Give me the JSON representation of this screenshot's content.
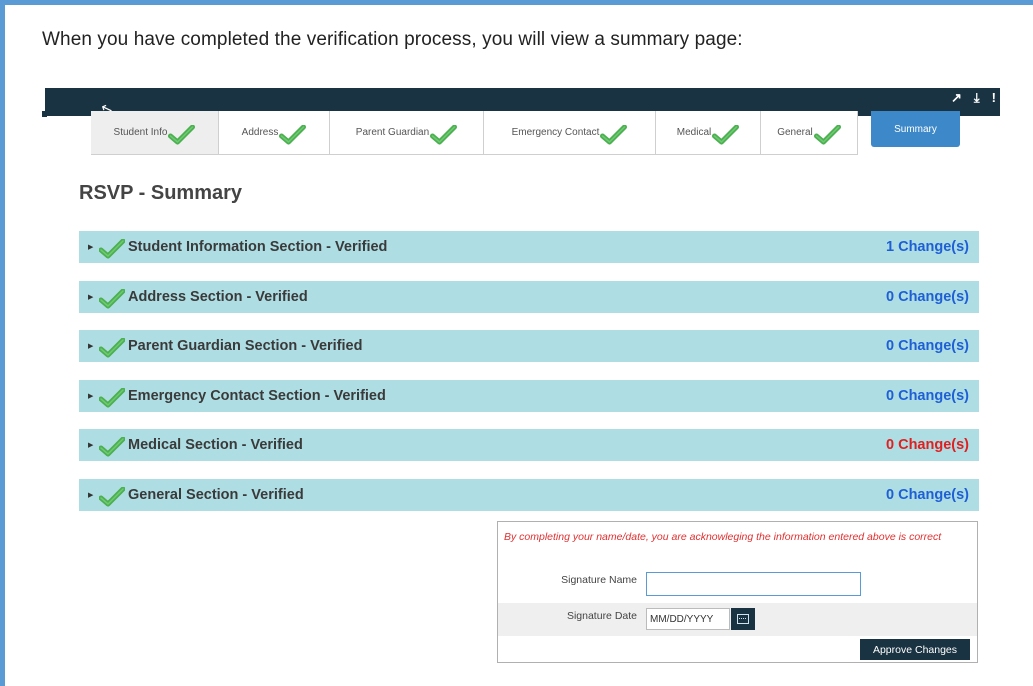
{
  "intro_text": "When you have completed the verification process, you will view a summary page:",
  "topbar": {
    "icons": [
      "external-link-icon",
      "download-icon",
      "alert-icon"
    ],
    "color": "#1a3342"
  },
  "tabs": [
    {
      "label": "Student Info",
      "verified": true
    },
    {
      "label": "Address",
      "verified": true
    },
    {
      "label": "Parent Guardian",
      "verified": true
    },
    {
      "label": "Emergency Contact",
      "verified": true
    },
    {
      "label": "Medical",
      "verified": true
    },
    {
      "label": "General",
      "verified": true
    },
    {
      "label": "Summary",
      "active": true
    }
  ],
  "title": "RSVP - Summary",
  "sections": [
    {
      "label": "Student Information Section - Verified",
      "changes": "1 Change(s)",
      "changes_color": "#1f5fd6"
    },
    {
      "label": "Address Section - Verified",
      "changes": "0 Change(s)",
      "changes_color": "#1f5fd6"
    },
    {
      "label": "Parent Guardian Section - Verified",
      "changes": "0 Change(s)",
      "changes_color": "#1f5fd6"
    },
    {
      "label": "Emergency Contact Section - Verified",
      "changes": "0 Change(s)",
      "changes_color": "#1f5fd6"
    },
    {
      "label": "Medical Section - Verified",
      "changes": "0 Change(s)",
      "changes_color": "#e02020"
    },
    {
      "label": "General Section - Verified",
      "changes": "0 Change(s)",
      "changes_color": "#1f5fd6"
    }
  ],
  "signature": {
    "disclaimer": "By completing your name/date, you are acknowleging the information entered above is correct",
    "name_label": "Signature Name",
    "name_value": "",
    "date_label": "Signature Date",
    "date_placeholder": "MM/DD/YYYY",
    "approve_label": "Approve Changes"
  },
  "colors": {
    "section_bg": "#aedee4",
    "check_green": "#4caf50",
    "summary_tab": "#3d88c8",
    "frame": "#5b9bd5"
  }
}
